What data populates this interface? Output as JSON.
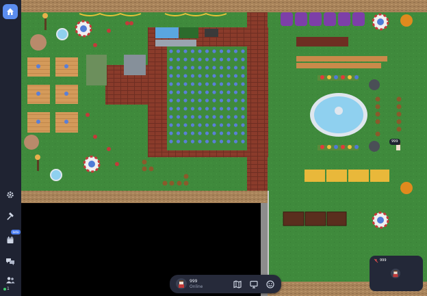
{
  "sidebar": {
    "items": [
      {
        "name": "home",
        "icon": "home-icon"
      },
      {
        "name": "settings",
        "icon": "gear-icon"
      },
      {
        "name": "build",
        "icon": "hammer-icon"
      },
      {
        "name": "calendar",
        "icon": "calendar-icon",
        "badge": "beta"
      },
      {
        "name": "chat",
        "icon": "chat-bubbles-icon"
      },
      {
        "name": "participants",
        "icon": "people-icon"
      }
    ],
    "online_count": "1"
  },
  "bottom_bar": {
    "user_name": "999",
    "user_status": "Online",
    "buttons": [
      "map-icon",
      "screen-share-icon",
      "emoji-icon"
    ]
  },
  "player": {
    "name_tag": "999"
  },
  "mini_panel": {
    "count": "999"
  },
  "colors": {
    "grass": "#3f8a3c",
    "grass_dark": "#377a35",
    "wall": "#a8835a",
    "brick": "#8a3b2b",
    "brick_dark": "#6e2e22",
    "water": "#8fd0ef",
    "table": "#d49a5a",
    "sidebar_bg": "#1f2332",
    "accent": "#5b8def",
    "void": "#000000"
  }
}
